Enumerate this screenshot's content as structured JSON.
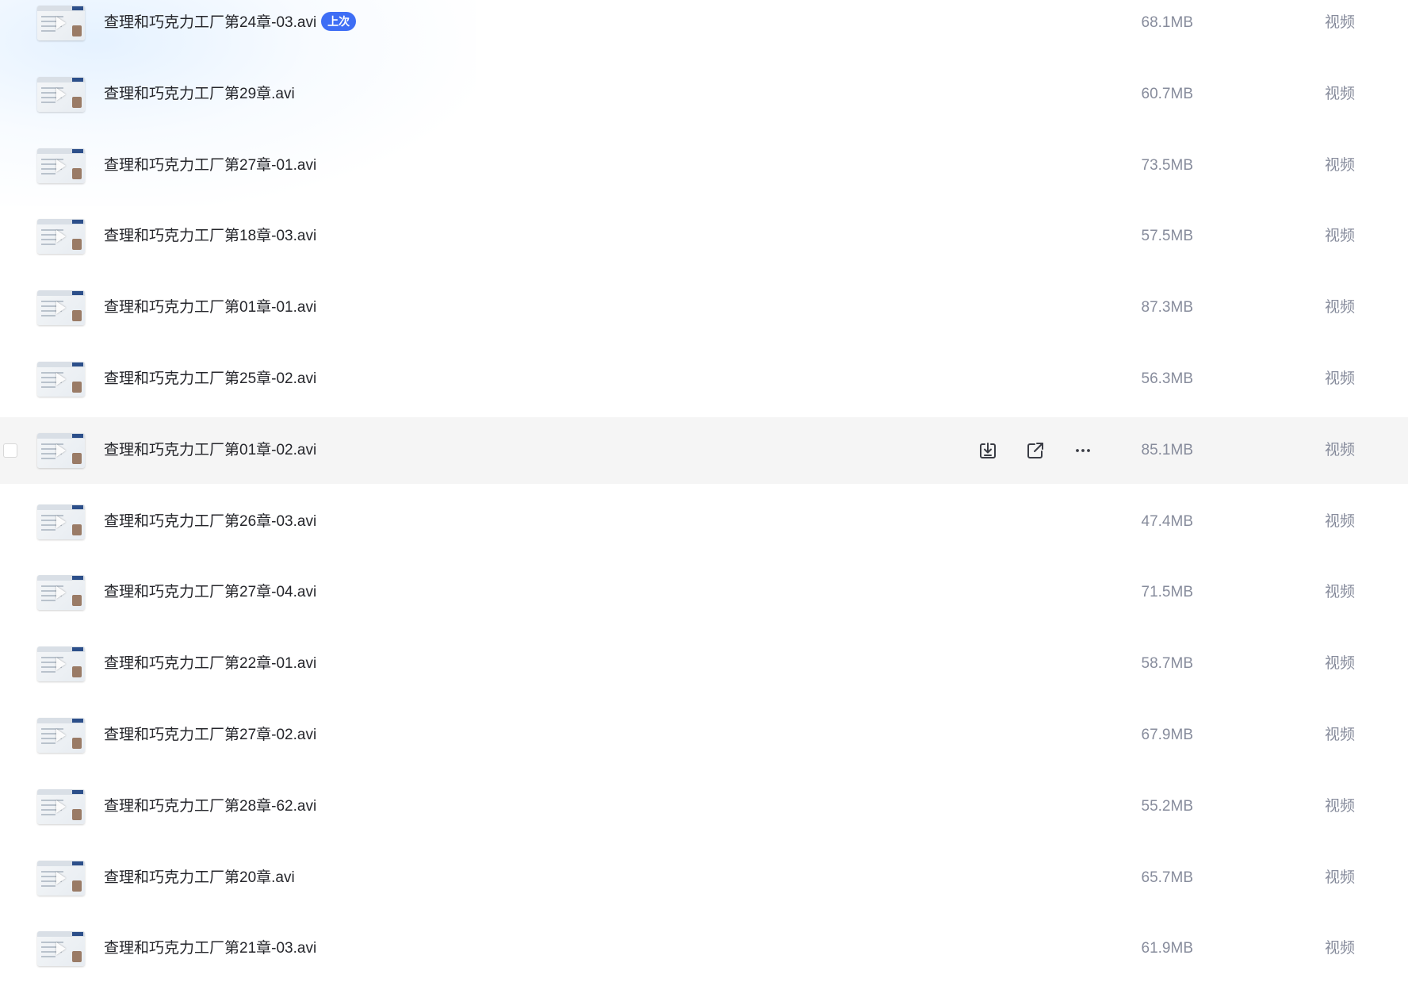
{
  "files": [
    {
      "name": "查理和巧克力工厂第24章-03.avi",
      "badge": "上次",
      "size": "68.1MB",
      "type": "视频"
    },
    {
      "name": "查理和巧克力工厂第29章.avi",
      "size": "60.7MB",
      "type": "视频"
    },
    {
      "name": "查理和巧克力工厂第27章-01.avi",
      "size": "73.5MB",
      "type": "视频"
    },
    {
      "name": "查理和巧克力工厂第18章-03.avi",
      "size": "57.5MB",
      "type": "视频"
    },
    {
      "name": "查理和巧克力工厂第01章-01.avi",
      "size": "87.3MB",
      "type": "视频"
    },
    {
      "name": "查理和巧克力工厂第25章-02.avi",
      "size": "56.3MB",
      "type": "视频"
    },
    {
      "name": "查理和巧克力工厂第01章-02.avi",
      "size": "85.1MB",
      "type": "视频",
      "hovered": true
    },
    {
      "name": "查理和巧克力工厂第26章-03.avi",
      "size": "47.4MB",
      "type": "视频"
    },
    {
      "name": "查理和巧克力工厂第27章-04.avi",
      "size": "71.5MB",
      "type": "视频"
    },
    {
      "name": "查理和巧克力工厂第22章-01.avi",
      "size": "58.7MB",
      "type": "视频"
    },
    {
      "name": "查理和巧克力工厂第27章-02.avi",
      "size": "67.9MB",
      "type": "视频"
    },
    {
      "name": "查理和巧克力工厂第28章-62.avi",
      "size": "55.2MB",
      "type": "视频"
    },
    {
      "name": "查理和巧克力工厂第20章.avi",
      "size": "65.7MB",
      "type": "视频"
    },
    {
      "name": "查理和巧克力工厂第21章-03.avi",
      "size": "61.9MB",
      "type": "视频"
    }
  ],
  "row_actions": [
    {
      "icon": "download-icon"
    },
    {
      "icon": "share-icon"
    },
    {
      "icon": "more-icon"
    }
  ],
  "colors": {
    "badge": "#3e6ef5",
    "hover_row": "#f5f5f5",
    "text_primary": "#25262b",
    "text_secondary": "#878c9c"
  }
}
